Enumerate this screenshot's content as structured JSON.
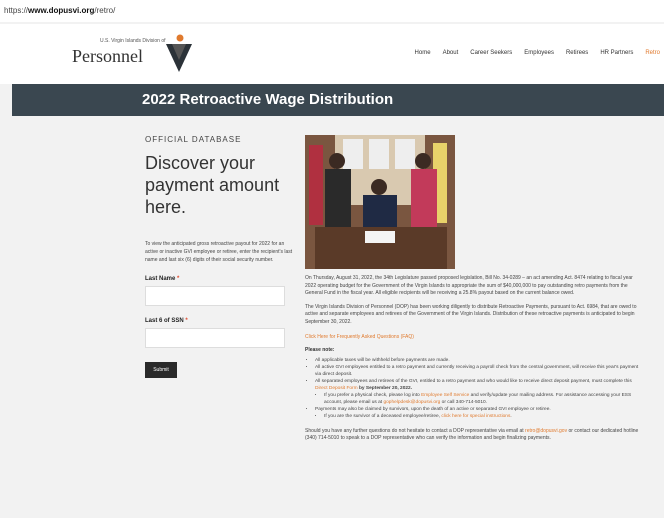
{
  "url": {
    "prefix": "https://",
    "domain": "www.dopusvi.org",
    "path": "/retro/"
  },
  "logo": {
    "small": "U.S. Virgin Islands Division of",
    "main": "Personnel"
  },
  "nav": [
    "Home",
    "About",
    "Career Seekers",
    "Employees",
    "Retirees",
    "HR Partners",
    "Retro"
  ],
  "banner_title": "2022 Retroactive Wage Distribution",
  "left": {
    "kicker": "OFFICIAL DATABASE",
    "headline": "Discover your payment amount here.",
    "intro": "To view the anticipated gross retroactive payout for 2022 for an active or inactive GVI employee or retiree, enter the recipient's last name and last six (6) digits of their social security number.",
    "last_name_label": "Last Name",
    "ssn_label": "Last 6 of SSN",
    "required_mark": "*",
    "submit": "Submit"
  },
  "right": {
    "para1": "On Thursday, August 31, 2022, the 34th Legislature passed proposed legislation, Bill No. 34-0289 – an act amending Act. 8474 relating to fiscal year 2022 operating budget for the Government of the Virgin Islands to appropriate the sum of $40,000,000 to pay outstanding retro payments from the General Fund in the fiscal year. All eligible recipients will be receiving a 25.8% payout based on the current balance owed.",
    "para2": "The Virgin Islands Division of Personnel (DOP) has been working diligently to distribute Retroactive Payments, pursuant to Act. 6984, that are owed to active and separate employees and retirees of the Government of the Virgin Islands. Distribution of these retroactive payments is anticipated to begin September 30, 2022.",
    "faq": "Click Here for Frequently Asked Questions (FAQ)",
    "note": "Please note:",
    "b1": "All applicable taxes will be withheld before payments are made.",
    "b2": "All active GVI employees entitled to a retro payment and currently receiving a payroll check from the central government, will receive this year's payment via direct deposit.",
    "b3a": "All separated employees and retirees of the GVI, entitled to a retro payment and who would like to receive direct deposit payment, must complete this ",
    "b3link": "Direct Deposit Form",
    "b3b": " by September 20, 2022.",
    "s1a": "If you prefer a physical check, please log into ",
    "s1link": "Employee Self Service",
    "s1b": " and verify/update your mailing address. For assistance accessing your ESS account, please email us at ",
    "s1email": "gophelpdesk@dopusvi.org",
    "s1c": " or call 340-714-5010.",
    "b4": "Payments may also be claimed by survivors, upon the death of an active or separated GVI employee or retiree.",
    "s2a": "If you are the survivor of a deceased employee/retiree, ",
    "s2link": "click here for special instructions",
    "s2b": ".",
    "final_a": "Should you have any further questions do not hesitate to contact a DOP representative via email at ",
    "final_email": "retro@dopusvi.gov",
    "final_b": " or contact our dedicated hotline (340) 714-5010 to speak to a DOP representative who can verify the information and begin finalizing payments."
  },
  "colors": {
    "accent": "#e07a2e",
    "banner": "#3a4750"
  }
}
